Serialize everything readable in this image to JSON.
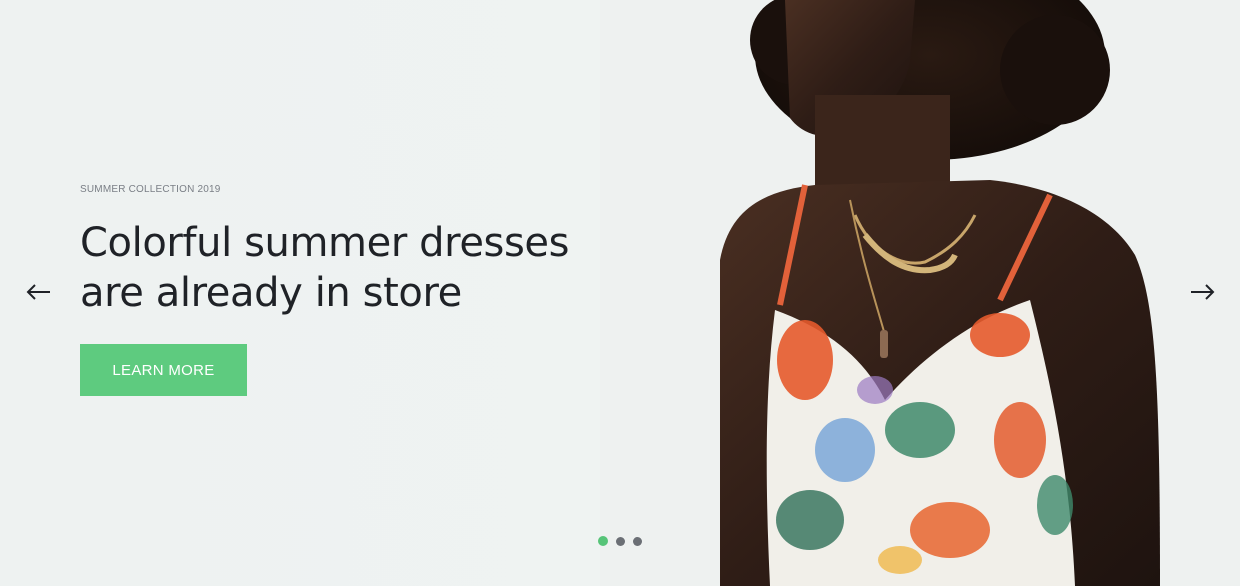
{
  "hero": {
    "eyebrow": "SUMMER COLLECTION 2019",
    "headline_line1": "Colorful summer dresses",
    "headline_line2": "are already in store",
    "cta_label": "LEARN MORE",
    "accent_color": "#5ecb7f",
    "background_color": "#eef2f1"
  },
  "navigation": {
    "prev_icon": "arrow-left-icon",
    "next_icon": "arrow-right-icon"
  },
  "pagination": {
    "total": 3,
    "active_index": 0
  }
}
